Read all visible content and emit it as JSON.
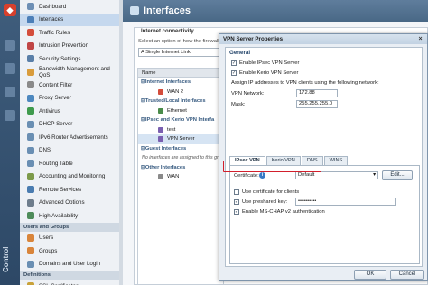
{
  "app": {
    "brand": "Control"
  },
  "sidebar": {
    "items": [
      {
        "label": "Dashboard",
        "color": "#6d8fb5"
      },
      {
        "label": "Interfaces",
        "color": "#4c7fb8",
        "active": true
      },
      {
        "label": "Traffic Rules",
        "color": "#d44d3b"
      },
      {
        "label": "Intrusion Prevention",
        "color": "#c04545"
      },
      {
        "label": "Security Settings",
        "color": "#5a7fa8"
      },
      {
        "label": "Bandwidth Management and QoS",
        "color": "#d99c3c"
      },
      {
        "label": "Content Filter",
        "color": "#8a8a8a"
      },
      {
        "label": "Proxy Server",
        "color": "#4d88bf"
      },
      {
        "label": "Antivirus",
        "color": "#3e9a4d"
      },
      {
        "label": "DHCP Server",
        "color": "#6a8fb3"
      },
      {
        "label": "IPv6 Router Advertisements",
        "color": "#6a8fb3"
      },
      {
        "label": "DNS",
        "color": "#6a8fb3"
      },
      {
        "label": "Routing Table",
        "color": "#6a8fb3"
      },
      {
        "label": "Accounting and Monitoring",
        "color": "#7c9a4a"
      },
      {
        "label": "Remote Services",
        "color": "#4a7cb0"
      },
      {
        "label": "Advanced Options",
        "color": "#6e7d8c"
      },
      {
        "label": "High Availability",
        "color": "#4e8c5a"
      }
    ],
    "section_users": "Users and Groups",
    "user_items": [
      {
        "label": "Users",
        "color": "#d9853b"
      },
      {
        "label": "Groups",
        "color": "#d9853b"
      },
      {
        "label": "Domains and User Login",
        "color": "#6a8fb3"
      }
    ],
    "section_definitions": "Definitions",
    "definition_items": [
      {
        "label": "SSL Certificates",
        "color": "#c9a23a"
      }
    ]
  },
  "header": {
    "title": "Interfaces"
  },
  "connectivity": {
    "label": "Internet connectivity",
    "text": "Select an option of how the firewall is",
    "select_value": "A Single Internet Link"
  },
  "interfaces": {
    "column_header": "Name",
    "groups": [
      {
        "name": "Internet Interfaces",
        "children": [
          "WAN 2"
        ]
      },
      {
        "name": "Trusted/Local Interfaces",
        "children": [
          "Ethernet"
        ]
      },
      {
        "name": "IPsec and Kerio VPN Interfa",
        "children": [
          "test",
          "VPN Server"
        ]
      },
      {
        "name": "Guest Interfaces",
        "children": []
      },
      {
        "name": "Other Interfaces",
        "children": [
          "WAN"
        ]
      }
    ],
    "guest_note": "No interfaces are assigned to this gr"
  },
  "dialog": {
    "title": "VPN Server Properties",
    "close": "×",
    "general_heading": "General",
    "enable_ipsec": "Enable IPsec VPN Server",
    "enable_kerio": "Enable Kerio VPN Server",
    "assign_text": "Assign IP addresses to VPN clients using the following network:",
    "vpn_network_label": "VPN Network:",
    "vpn_network_value": "172.88",
    "mask_label": "Mask:",
    "mask_value": "255.255.255.0",
    "tabs": [
      "IPsec VPN",
      "Kerio VPN",
      "DNS",
      "WINS"
    ],
    "certificate_label": "Certificate:",
    "certificate_value": "Default",
    "edit_button": "Edit...",
    "use_cert_clients": "Use certificate for clients",
    "use_psk": "Use preshared key:",
    "psk_value": "••••••••••",
    "enable_mschap": "Enable MS-CHAP v2 authentication",
    "ok": "OK",
    "cancel": "Cancel"
  },
  "colors": {
    "highlight": "#d21f2c",
    "header": "#496886"
  }
}
